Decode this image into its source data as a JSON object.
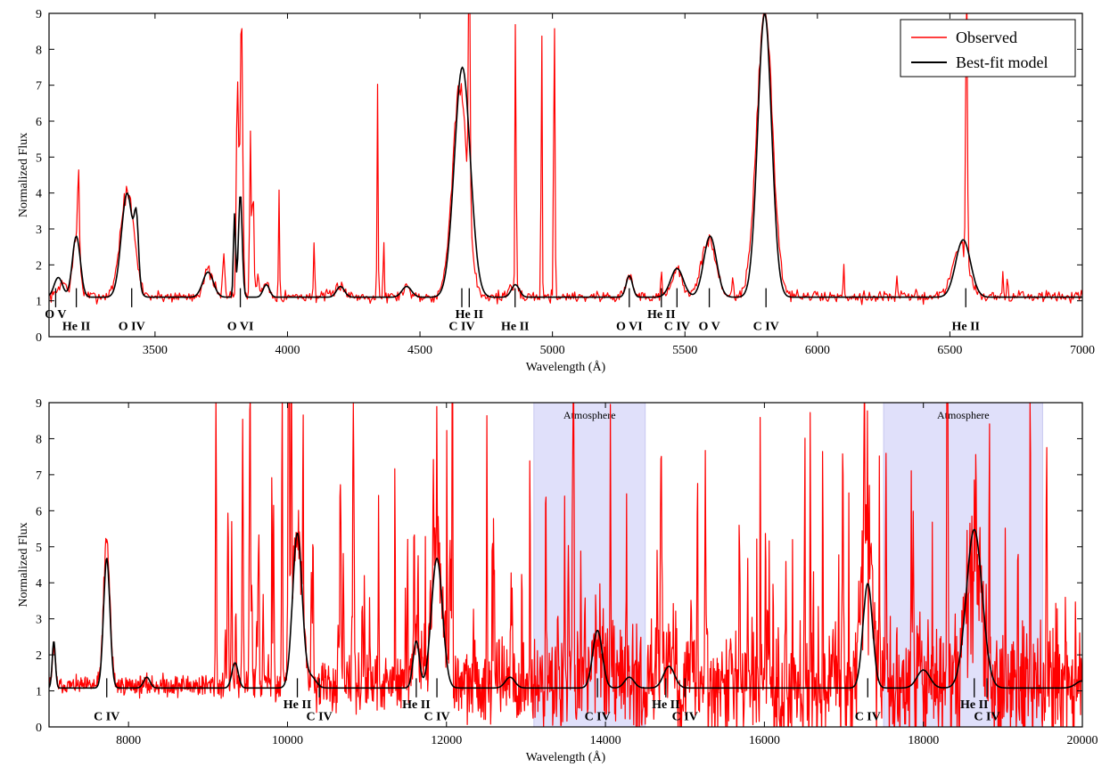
{
  "chart_data": [
    {
      "type": "line",
      "id": "optical",
      "xlabel": "Wavelength (Å)",
      "ylabel": "Normalized Flux",
      "xlim": [
        3100,
        7000
      ],
      "ylim": [
        0,
        9
      ],
      "xticks": [
        3500,
        4000,
        4500,
        5000,
        5500,
        6000,
        6500,
        7000
      ],
      "yticks": [
        0,
        1,
        2,
        3,
        4,
        5,
        6,
        7,
        8,
        9
      ],
      "grid": false,
      "legend": {
        "placement": "top-right",
        "entries": [
          "Observed",
          "Best-fit model"
        ]
      },
      "series": [
        {
          "name": "Observed",
          "color": "#ff0000",
          "continuum": 1.12,
          "noise": 0.1,
          "seed": 7,
          "spacing": 4,
          "lines": [
            [
              3150,
              0.4,
              15
            ],
            [
              3203,
              1.6,
              13
            ],
            [
              3211,
              2.4,
              3
            ],
            [
              3395,
              2.9,
              26
            ],
            [
              3700,
              0.7,
              18
            ],
            [
              3760,
              1.3,
              4
            ],
            [
              3811,
              6.2,
              4
            ],
            [
              3826,
              7.9,
              5
            ],
            [
              3860,
              4.6,
              3
            ],
            [
              3870,
              3.1,
              3
            ],
            [
              3889,
              0.6,
              6
            ],
            [
              3920,
              0.4,
              10
            ],
            [
              3968,
              3.2,
              2
            ],
            [
              4101,
              1.7,
              2
            ],
            [
              4200,
              0.35,
              15
            ],
            [
              4340,
              5.8,
              2
            ],
            [
              4363,
              1.6,
              2
            ],
            [
              4450,
              0.25,
              15
            ],
            [
              4650,
              5.8,
              28
            ],
            [
              4686,
              7.8,
              3
            ],
            [
              4850,
              0.3,
              15
            ],
            [
              4861,
              8.0,
              2
            ],
            [
              4959,
              8.0,
              2
            ],
            [
              5007,
              8.0,
              2.5
            ],
            [
              5290,
              0.6,
              12
            ],
            [
              5411,
              0.6,
              3
            ],
            [
              5470,
              0.7,
              22
            ],
            [
              5590,
              1.6,
              26
            ],
            [
              5680,
              0.6,
              3
            ],
            [
              5801,
              7.9,
              30
            ],
            [
              6100,
              0.9,
              2
            ],
            [
              6300,
              0.6,
              2
            ],
            [
              6540,
              1.4,
              30
            ],
            [
              6563,
              7.9,
              3
            ],
            [
              6700,
              0.8,
              2
            ],
            [
              6717,
              0.6,
              2
            ]
          ]
        },
        {
          "name": "Best-fit model",
          "color": "#000000",
          "continuum": 1.1,
          "noise": 0,
          "seed": 1,
          "spacing": 4,
          "lines": [
            [
              3135,
              0.55,
              16
            ],
            [
              3203,
              1.7,
              15
            ],
            [
              3395,
              2.9,
              22
            ],
            [
              3430,
              1.6,
              8
            ],
            [
              3700,
              0.7,
              20
            ],
            [
              3800,
              2.3,
              4
            ],
            [
              3822,
              2.9,
              7
            ],
            [
              3920,
              0.35,
              12
            ],
            [
              4200,
              0.3,
              15
            ],
            [
              4450,
              0.3,
              18
            ],
            [
              4660,
              6.4,
              30
            ],
            [
              4860,
              0.35,
              15
            ],
            [
              5290,
              0.6,
              12
            ],
            [
              5470,
              0.8,
              24
            ],
            [
              5595,
              1.7,
              24
            ],
            [
              5801,
              7.9,
              26
            ],
            [
              6550,
              1.6,
              28
            ]
          ]
        }
      ],
      "labels": [
        {
          "text": "O V",
          "x": 3125,
          "row": 0
        },
        {
          "text": "He II",
          "x": 3203,
          "row": 1
        },
        {
          "text": "O IV",
          "x": 3412,
          "row": 1
        },
        {
          "text": "O VI",
          "x": 3822,
          "row": 1
        },
        {
          "text": "He II",
          "x": 4686,
          "row": 0
        },
        {
          "text": "C IV",
          "x": 4658,
          "row": 1
        },
        {
          "text": "He II",
          "x": 4859,
          "row": 1
        },
        {
          "text": "O VI",
          "x": 5290,
          "row": 1
        },
        {
          "text": "He II",
          "x": 5411,
          "row": 0
        },
        {
          "text": "C IV",
          "x": 5470,
          "row": 1
        },
        {
          "text": "O V",
          "x": 5592,
          "row": 1
        },
        {
          "text": "C IV",
          "x": 5806,
          "row": 1
        },
        {
          "text": "He II",
          "x": 6560,
          "row": 1
        }
      ]
    },
    {
      "type": "line",
      "id": "infrared",
      "xlabel": "Wavelength (Å)",
      "ylabel": "Normalized Flux",
      "xlim": [
        7000,
        20000
      ],
      "ylim": [
        0,
        9
      ],
      "xticks": [
        8000,
        10000,
        12000,
        14000,
        16000,
        18000,
        20000
      ],
      "yticks": [
        0,
        1,
        2,
        3,
        4,
        5,
        6,
        7,
        8,
        9
      ],
      "grid": false,
      "bands": [
        {
          "label": "Atmosphere",
          "x0": 13100,
          "x1": 14500,
          "color": "#e0e0fa"
        },
        {
          "label": "Atmosphere",
          "x0": 17500,
          "x1": 19500,
          "color": "#e0e0fa"
        }
      ],
      "series": [
        {
          "name": "Observed",
          "color": "#ff0000",
          "continuum": 1.15,
          "seed": 11,
          "spacing": 6,
          "noise_ranges": [
            [
              7000,
              0.12
            ],
            [
              9000,
              0.2
            ],
            [
              10500,
              0.4
            ],
            [
              12500,
              0.6
            ],
            [
              13100,
              0.8
            ],
            [
              14500,
              0.85
            ],
            [
              17500,
              1.0
            ],
            [
              19500,
              1.1
            ],
            [
              20000,
              1.1
            ]
          ],
          "lines": [
            [
              7060,
              1.0,
              20
            ],
            [
              7726,
              4.0,
              40
            ],
            [
              9100,
              8.0,
              6
            ],
            [
              9530,
              8.0,
              6
            ],
            [
              10020,
              8.0,
              6
            ],
            [
              10124,
              4.2,
              60
            ],
            [
              10830,
              8.0,
              8
            ],
            [
              11620,
              1.3,
              40
            ],
            [
              11880,
              3.8,
              70
            ],
            [
              12820,
              3.0,
              10
            ],
            [
              13900,
              1.6,
              60
            ],
            [
              14700,
              8.0,
              10
            ],
            [
              14800,
              0.8,
              60
            ],
            [
              17300,
              4.0,
              60
            ],
            [
              18640,
              3.8,
              90
            ]
          ],
          "spikes": {
            "count": 110,
            "from": 9000,
            "to": 20000,
            "minAmp": 1.5,
            "maxAmp": 8,
            "width": 5
          }
        },
        {
          "name": "Best-fit model",
          "color": "#000000",
          "continuum": 1.08,
          "noise": 0,
          "seed": 3,
          "spacing": 8,
          "lines": [
            [
              7060,
              1.3,
              20
            ],
            [
              7726,
              3.6,
              40
            ],
            [
              8230,
              0.3,
              40
            ],
            [
              9340,
              0.7,
              40
            ],
            [
              10124,
              4.3,
              60
            ],
            [
              10300,
              0.3,
              60
            ],
            [
              11620,
              1.3,
              40
            ],
            [
              11880,
              3.6,
              70
            ],
            [
              12800,
              0.3,
              60
            ],
            [
              13900,
              1.6,
              60
            ],
            [
              14300,
              0.3,
              60
            ],
            [
              14800,
              0.6,
              70
            ],
            [
              17300,
              2.9,
              60
            ],
            [
              18000,
              0.5,
              80
            ],
            [
              18640,
              4.4,
              100
            ],
            [
              20000,
              0.2,
              80
            ]
          ]
        }
      ],
      "labels": [
        {
          "text": "C IV",
          "x": 7726,
          "row": 1
        },
        {
          "text": "He II",
          "x": 10124,
          "row": 0
        },
        {
          "text": "C IV",
          "x": 10400,
          "row": 1
        },
        {
          "text": "He II",
          "x": 11620,
          "row": 0
        },
        {
          "text": "C IV",
          "x": 11880,
          "row": 1
        },
        {
          "text": "C IV",
          "x": 13900,
          "row": 1
        },
        {
          "text": "He II",
          "x": 14760,
          "row": 0
        },
        {
          "text": "C IV",
          "x": 15000,
          "row": 1
        },
        {
          "text": "C IV",
          "x": 17300,
          "row": 1
        },
        {
          "text": "He II",
          "x": 18640,
          "row": 0
        },
        {
          "text": "C IV",
          "x": 18800,
          "row": 1
        }
      ]
    }
  ]
}
